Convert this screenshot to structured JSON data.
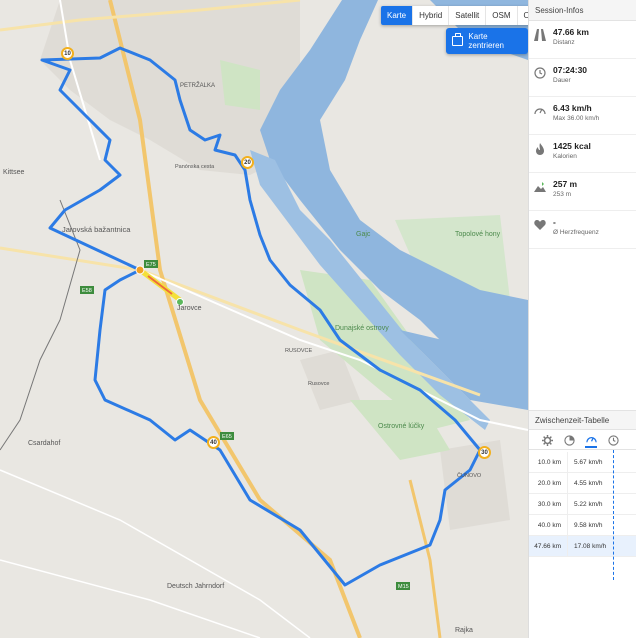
{
  "map": {
    "layers": [
      "Karte",
      "Hybrid",
      "Satellit",
      "OSM",
      "OCM"
    ],
    "active_layer": "Karte",
    "center_button": "Karte zentrieren",
    "labels": {
      "kittsee": "Kittsee",
      "jarovska": "Jarovská bažantnica",
      "jarovce": "Jarovce",
      "rusovce_small": "RUSOVCE",
      "rusovce": "Rusovce",
      "dunajske_ostrovy": "Dunajské ostrovy",
      "ostrovne_lucky": "Ostrovné lúčky",
      "topolove_hony": "Topolové hony",
      "gajc": "Gajc",
      "cunovo": "ČUNOVO",
      "csardahof": "Csardahof",
      "deutsch_jahrndorf": "Deutsch Jahrndorf",
      "rajka": "Rajka",
      "petrzalka": "PETRŽALKA",
      "panonska": "Panónska cesta",
      "route_e75": "E75",
      "route_e58": "E58",
      "route_e65": "E65",
      "route_m15": "M15"
    },
    "km_markers": [
      "10",
      "20",
      "30",
      "40"
    ],
    "route_color": "#2c7be5",
    "water_color": "#8fb6de"
  },
  "session": {
    "title": "Session-Infos",
    "stats": [
      {
        "icon": "road-icon",
        "value": "47.66 km",
        "label": "Distanz"
      },
      {
        "icon": "clock-icon",
        "value": "07:24:30",
        "label": "Dauer"
      },
      {
        "icon": "speedometer-icon",
        "value": "6.43 km/h",
        "label": "Max 36.00 km/h"
      },
      {
        "icon": "flame-icon",
        "value": "1425 kcal",
        "label": "Kalorien"
      },
      {
        "icon": "elevation-icon",
        "value": "257 m",
        "label": "253 m"
      },
      {
        "icon": "heart-icon",
        "value": "-",
        "label": "Ø Herzfrequenz"
      }
    ]
  },
  "splits": {
    "title": "Zwischenzeit-Tabelle",
    "tabs": [
      "gear-icon",
      "pie-icon",
      "speedometer-icon",
      "clock-icon"
    ],
    "active_tab": 2,
    "rows": [
      {
        "km": "10.0 km",
        "value": "5.67 km/h"
      },
      {
        "km": "20.0 km",
        "value": "4.55 km/h"
      },
      {
        "km": "30.0 km",
        "value": "5.22 km/h"
      },
      {
        "km": "40.0 km",
        "value": "9.58 km/h"
      },
      {
        "km": "47.66 km",
        "value": "17.08 km/h"
      }
    ]
  }
}
